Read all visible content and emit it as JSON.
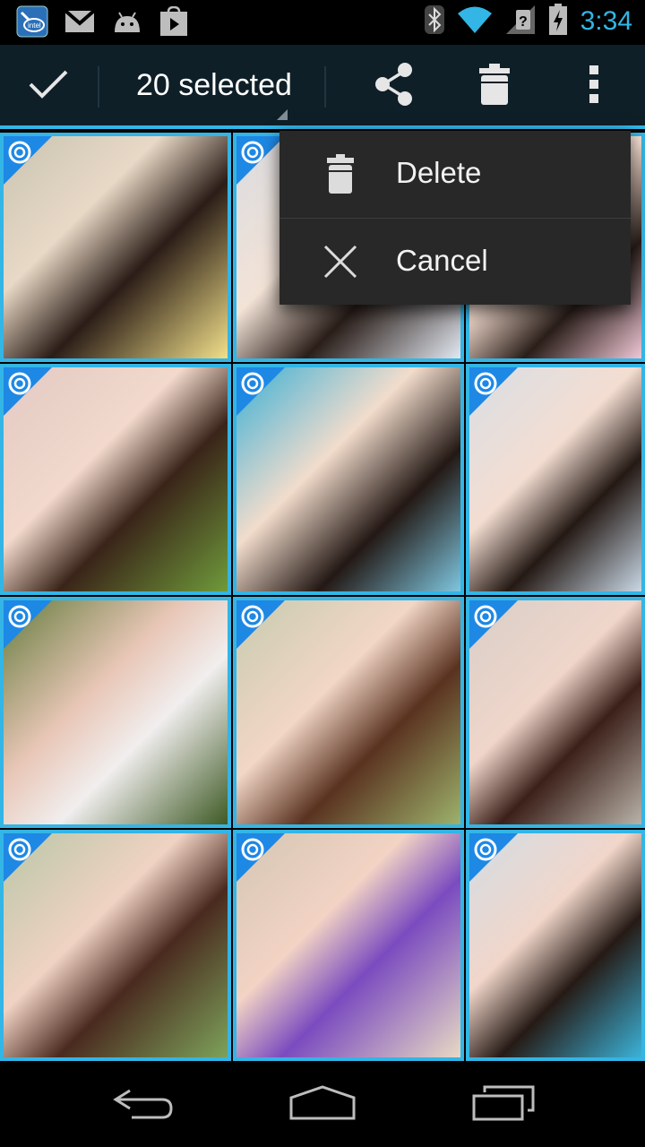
{
  "status_bar": {
    "time": "3:34",
    "icons_left": [
      "intel-app-icon",
      "gmail-icon",
      "android-debug-icon",
      "play-store-icon"
    ],
    "icons_right": [
      "bluetooth-icon",
      "wifi-icon",
      "no-sim-icon",
      "battery-charging-icon"
    ]
  },
  "action_bar": {
    "done_icon": "check-icon",
    "selection_title": "20 selected",
    "actions": [
      "share-icon",
      "trash-icon",
      "overflow-menu-icon"
    ]
  },
  "menu": {
    "items": [
      {
        "label": "Delete",
        "icon": "trash-icon"
      },
      {
        "label": "Cancel",
        "icon": "close-icon"
      }
    ]
  },
  "grid": {
    "selected_color": "#33b5e5",
    "badge_color": "#1e88e5",
    "tiles": [
      {
        "bg": "linear-gradient(135deg,#c9c3b2 0%,#e8d9c6 35%,#2b1d17 60%,#f2e08a 100%)"
      },
      {
        "bg": "linear-gradient(135deg,#d9dbe0 0%,#f3e3d7 40%,#2a1e19 65%,#e3e8f1 100%)"
      },
      {
        "bg": "linear-gradient(135deg,#e9e2dc 0%,#f4ddd0 45%,#2a1e19 70%,#f0c7d6 100%)"
      },
      {
        "bg": "linear-gradient(135deg,#e2c9c3 0%,#f2d9cc 40%,#3a2419 62%,#6f9a3a 100%)"
      },
      {
        "bg": "linear-gradient(135deg,#3bb0d6 0%,#f2dccc 40%,#231814 68%,#7ec6df 100%)"
      },
      {
        "bg": "linear-gradient(135deg,#d9dfe6 0%,#f3ddd1 42%,#241914 66%,#c9d8e6 100%)"
      },
      {
        "bg": "linear-gradient(135deg,#667d3f 0%,#e8c6b6 40%,#f1eeee 62%,#3f5a25 100%)"
      },
      {
        "bg": "linear-gradient(135deg,#c7cbb0 0%,#f2d6c6 40%,#5a3220 64%,#9db26b 100%)"
      },
      {
        "bg": "linear-gradient(135deg,#d8cec8 0%,#f0d6ca 42%,#3b2019 64%,#b9b2a8 100%)"
      },
      {
        "bg": "linear-gradient(135deg,#b9c7a7 0%,#f0d2c3 40%,#4a2a1f 62%,#7da25a 100%)"
      },
      {
        "bg": "linear-gradient(135deg,#d4c6b3 0%,#f2d3c4 38%,#7a4bbf 60%,#e7d9c4 100%)"
      },
      {
        "bg": "linear-gradient(135deg,#d3dde5 0%,#f1d6ca 40%,#261a15 64%,#3bb2d8 100%)"
      }
    ]
  },
  "nav_bar": {
    "buttons": [
      "back-icon",
      "home-icon",
      "recents-icon"
    ]
  }
}
